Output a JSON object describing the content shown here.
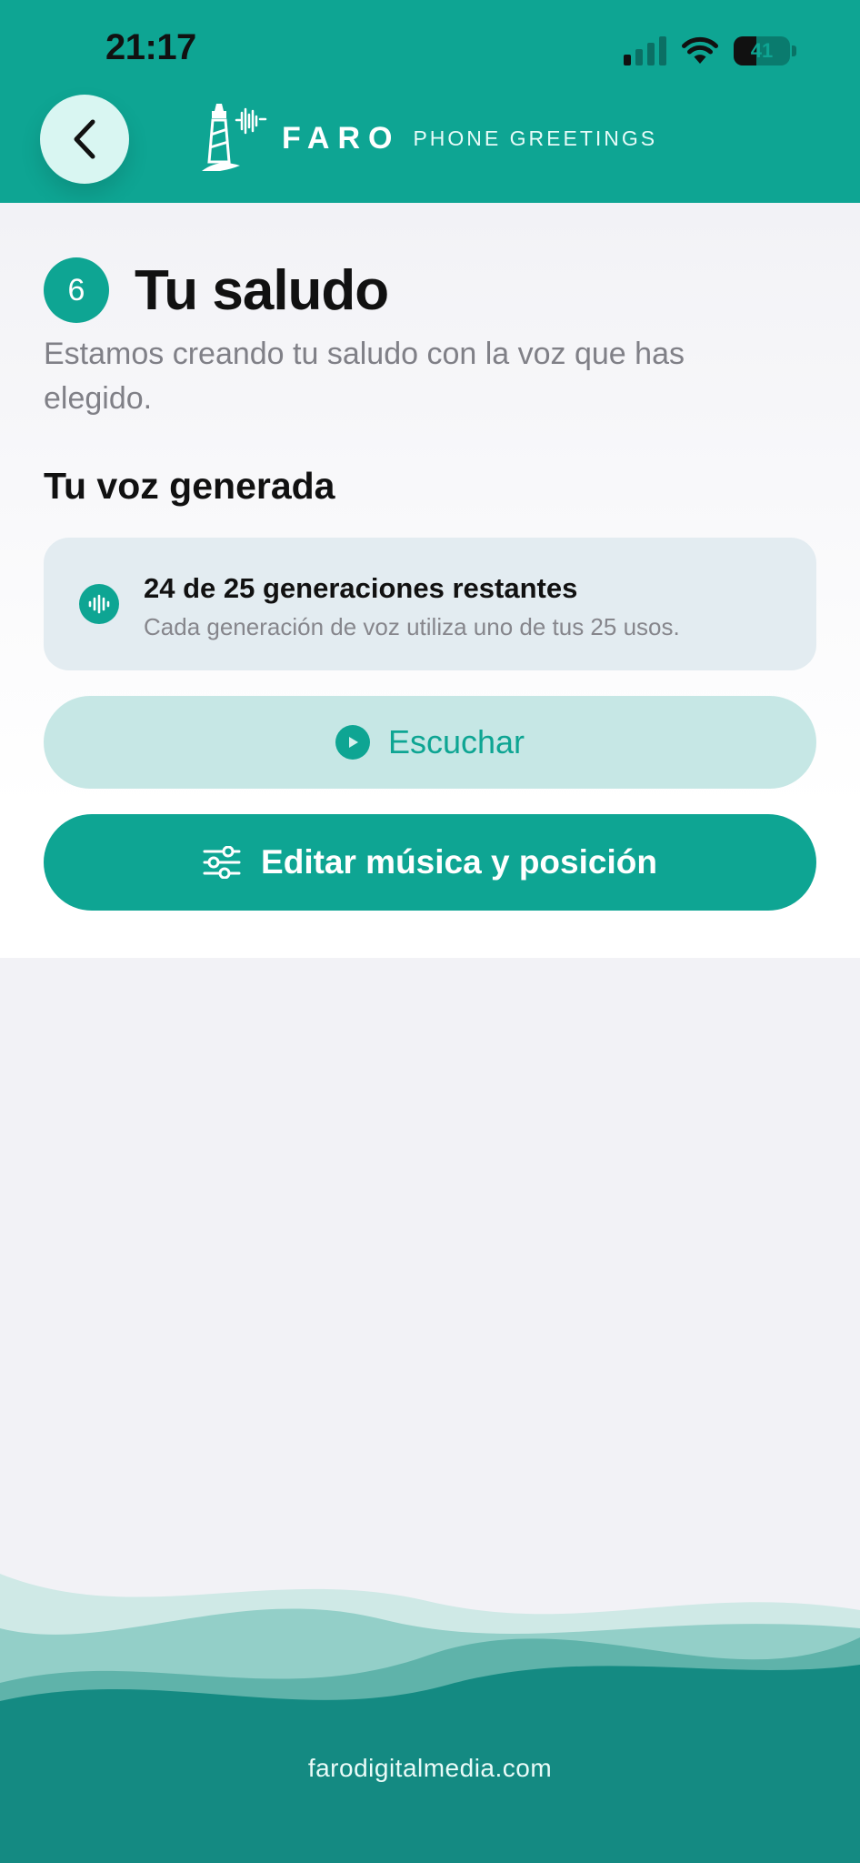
{
  "status_bar": {
    "time": "21:17",
    "battery_level": "41",
    "battery_fraction": 0.41,
    "signal_bars_active": 1
  },
  "header": {
    "back_icon": "chevron-left-icon",
    "logo": {
      "brand": "FARO",
      "tagline": "PHONE GREETINGS",
      "icon": "lighthouse-soundwave-logo"
    }
  },
  "main": {
    "step_number": "6",
    "title": "Tu saludo",
    "subtitle": "Estamos creando tu saludo con la voz que has elegido.",
    "section_title": "Tu voz generada",
    "usage_card": {
      "icon": "soundwave-icon",
      "title": "24 de 25 generaciones restantes",
      "description": "Cada generación de voz utiliza uno de tus 25 usos."
    },
    "listen_button": {
      "label": "Escuchar",
      "icon": "play-icon"
    },
    "edit_button": {
      "label": "Editar música y posición",
      "icon": "sliders-icon"
    }
  },
  "footer": {
    "link": "farodigitalmedia.com"
  },
  "colors": {
    "primary": "#0ea593",
    "listen_button_bg": "#c6e7e5",
    "info_card_bg": "#e3ecf1",
    "page_bg": "#f2f2f6"
  }
}
